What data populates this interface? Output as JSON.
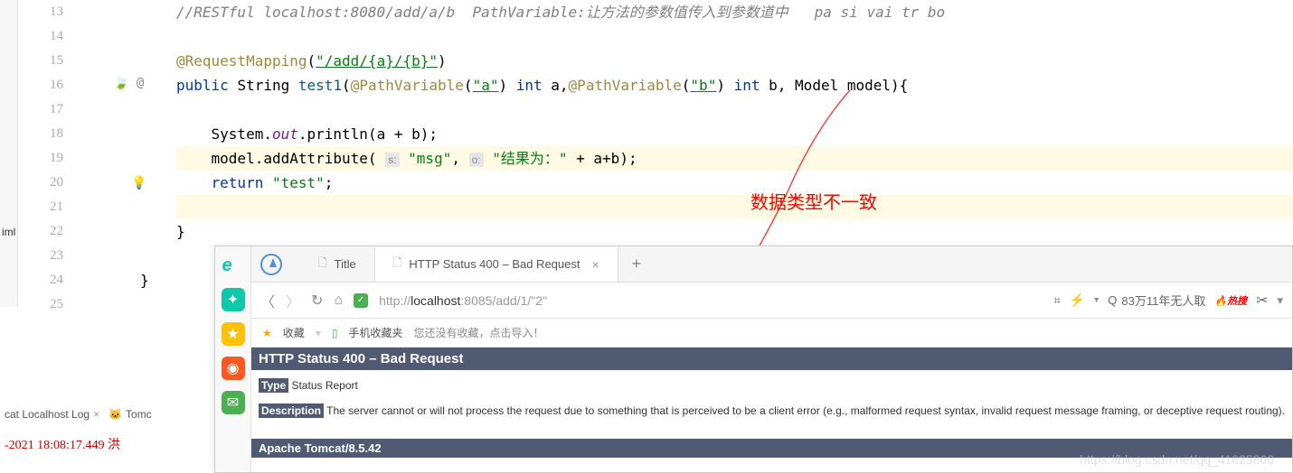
{
  "editor": {
    "lines": [
      {
        "num": "13",
        "content": "//RESTful localhost:8080/add/a/b  PathVariable:让方法的参数值传入到参数道中   pa si vai tr bo",
        "type": "comment"
      },
      {
        "num": "14",
        "content": ""
      },
      {
        "num": "15"
      },
      {
        "num": "16"
      },
      {
        "num": "17",
        "content": ""
      },
      {
        "num": "18"
      },
      {
        "num": "19"
      },
      {
        "num": "20"
      },
      {
        "num": "21",
        "content": ""
      },
      {
        "num": "22",
        "content": "}"
      },
      {
        "num": "23",
        "content": ""
      },
      {
        "num": "24",
        "content": "}"
      },
      {
        "num": "25",
        "content": ""
      }
    ],
    "line15": {
      "anno": "@RequestMapping",
      "paren_open": "(",
      "str": "\"/add/{a}/{b}\"",
      "paren_close": ")"
    },
    "line16": {
      "kw_public": "public",
      "type_string": "String",
      "method": "test1",
      "anno1": "@PathVariable",
      "str_a": "\"a\"",
      "kw_int1": "int",
      "var_a": "a,",
      "anno2": "@PathVariable",
      "str_b": "\"b\"",
      "kw_int2": "int",
      "var_b": "b,",
      "model": "Model model){",
      "at_symbol": "@"
    },
    "line18": {
      "pre": "    System.",
      "out": "out",
      "post": ".println(a + b);"
    },
    "line19": {
      "pre": "    model.addAttribute( ",
      "hint1": "s:",
      "str1": " \"msg\"",
      "comma": ", ",
      "hint2": "o:",
      "str2": " \"结果为：\"",
      "post": " + a+b);"
    },
    "line20": {
      "kw_return": "    return ",
      "str": "\"test\"",
      "semi": ";"
    },
    "red_annotation": "数据类型不一致"
  },
  "left_file": "iml",
  "bottom_tabs": {
    "tab1": "cat Localhost Log",
    "tab2": "Tomc"
  },
  "log_line": "-2021 18:08:17.449 洪",
  "browser": {
    "tab1_title": "Title",
    "tab2_title": "HTTP Status 400 – Bad Request",
    "url_prefix": "http://",
    "url_host": "localhost",
    "url_path": ":8085/add/1/\"2\"",
    "search_text": "83万11年无人取",
    "hot_label": "热搜",
    "bookmark_fav": "收藏",
    "bookmark_mobile": "手机收藏夹",
    "bookmark_hint": "您还没有收藏，点击导入！",
    "error": {
      "title": "HTTP Status 400 – Bad Request",
      "type_label": "Type",
      "type_value": "Status Report",
      "desc_label": "Description",
      "desc_value": "The server cannot or will not process the request due to something that is perceived to be a client error (e.g., malformed request syntax, invalid request message framing, or deceptive request routing).",
      "footer": "Apache Tomcat/8.5.42"
    },
    "watermark": "https://blog.csdn.net/qq_41625866"
  }
}
